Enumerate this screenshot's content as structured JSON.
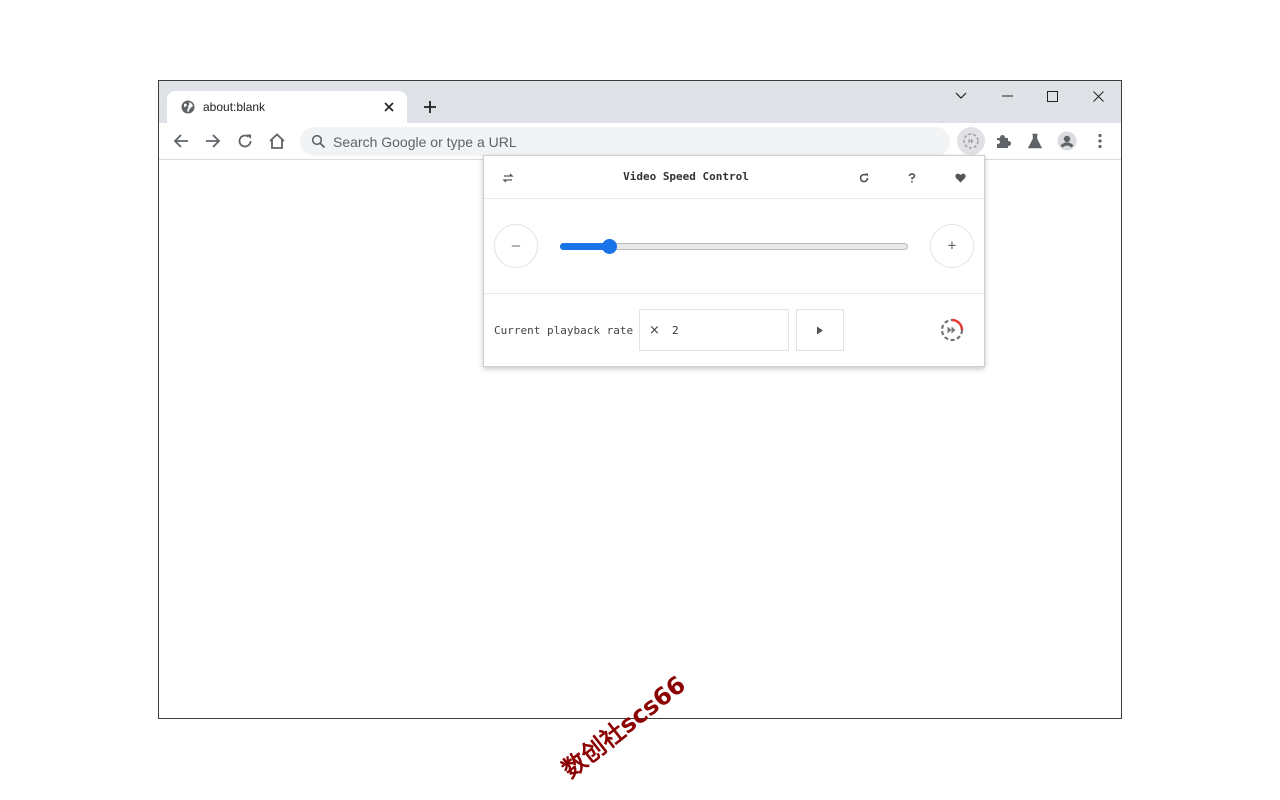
{
  "tab": {
    "title": "about:blank"
  },
  "omnibox": {
    "placeholder": "Search Google or type a URL"
  },
  "popup": {
    "title": "Video Speed Control",
    "minus_label": "–",
    "plus_label": "+",
    "rate_label": "Current playback rate",
    "rate_prefix": "×",
    "rate_value": "2",
    "slider_fraction": 0.14
  },
  "watermark": "数创社scs66",
  "colors": {
    "accent": "#1a73e8",
    "tabstrip": "#dee1e6",
    "omnibox": "#f1f3f4",
    "logo_red": "#e53935"
  }
}
